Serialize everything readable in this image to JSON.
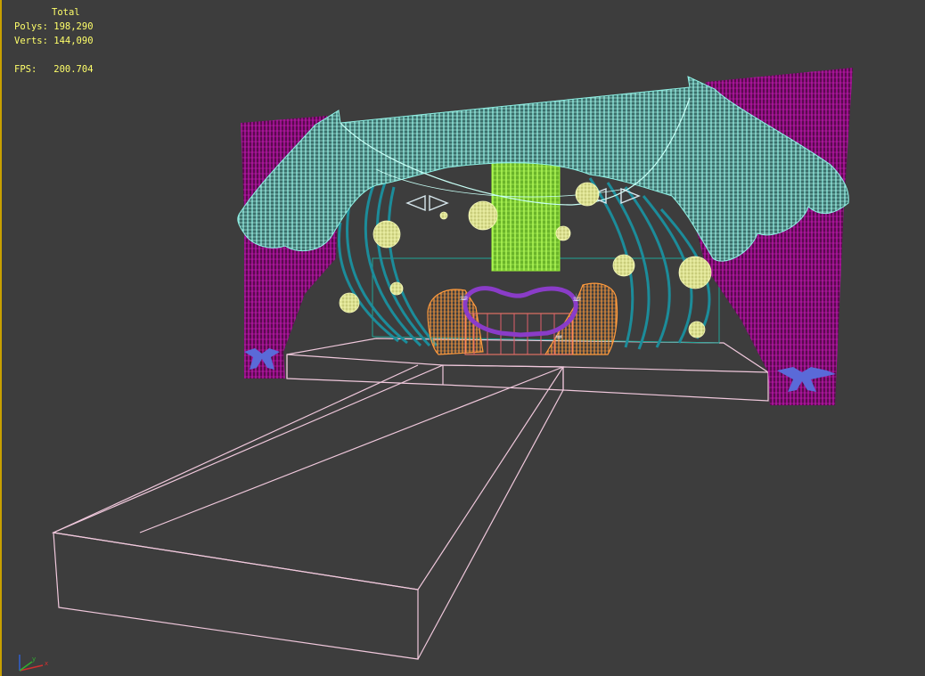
{
  "viewport": {
    "stats": {
      "total_label": "Total",
      "polys_label": "Polys:",
      "polys_value": "198,290",
      "verts_label": "Verts:",
      "verts_value": "144,090",
      "fps_label": "FPS:",
      "fps_value": "200.704"
    },
    "colors": {
      "background": "#3d3d3d",
      "border": "#c8a000",
      "stats_text": "#ffff6a",
      "curtain": "#8c0f78",
      "drape": "#7fe6d8",
      "drape_strings": "#1b8a96",
      "banner": "#9cf03c",
      "spheres": "#e8ec9c",
      "stage_lines": "#f5c8e0",
      "sofa": "#ff9a3c",
      "heart": "#8a3cc8",
      "tiebacks": "#5a6ad8"
    },
    "icons": {
      "axis_gizmo": "axis-tripod-icon"
    }
  }
}
